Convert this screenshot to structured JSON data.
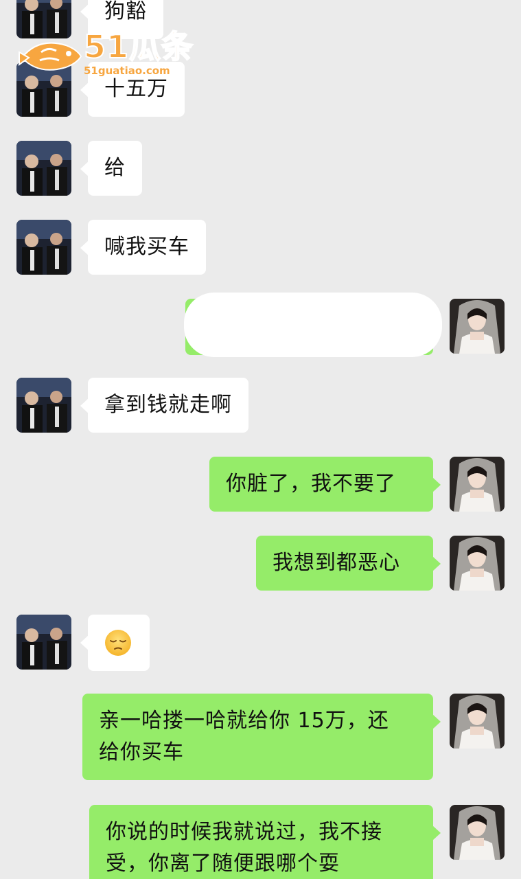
{
  "watermark": {
    "brand": "51瓜条",
    "domain": "51guatiao.com"
  },
  "messages": [
    {
      "side": "left",
      "text": "狗豁"
    },
    {
      "side": "left",
      "text": "十五万"
    },
    {
      "side": "left",
      "text": "给"
    },
    {
      "side": "left",
      "text": "喊我买车"
    },
    {
      "side": "right",
      "text": "",
      "redacted": true
    },
    {
      "side": "left",
      "text": "拿到钱就走啊"
    },
    {
      "side": "right",
      "text": "你脏了，我不要了"
    },
    {
      "side": "right",
      "text": "我想到都恶心"
    },
    {
      "side": "left",
      "text": "😔",
      "is_emoji": true
    },
    {
      "side": "right",
      "lines": [
        "亲一哈搂一哈就给你 15万，还",
        "给你买车"
      ]
    },
    {
      "side": "right",
      "lines": [
        "你说的时候我就说过，我不接",
        "受，你离了随便跟哪个耍"
      ]
    }
  ],
  "colors": {
    "background": "#ebebeb",
    "incoming_bubble": "#ffffff",
    "outgoing_bubble": "#95ec69",
    "watermark": "#f7a640"
  }
}
